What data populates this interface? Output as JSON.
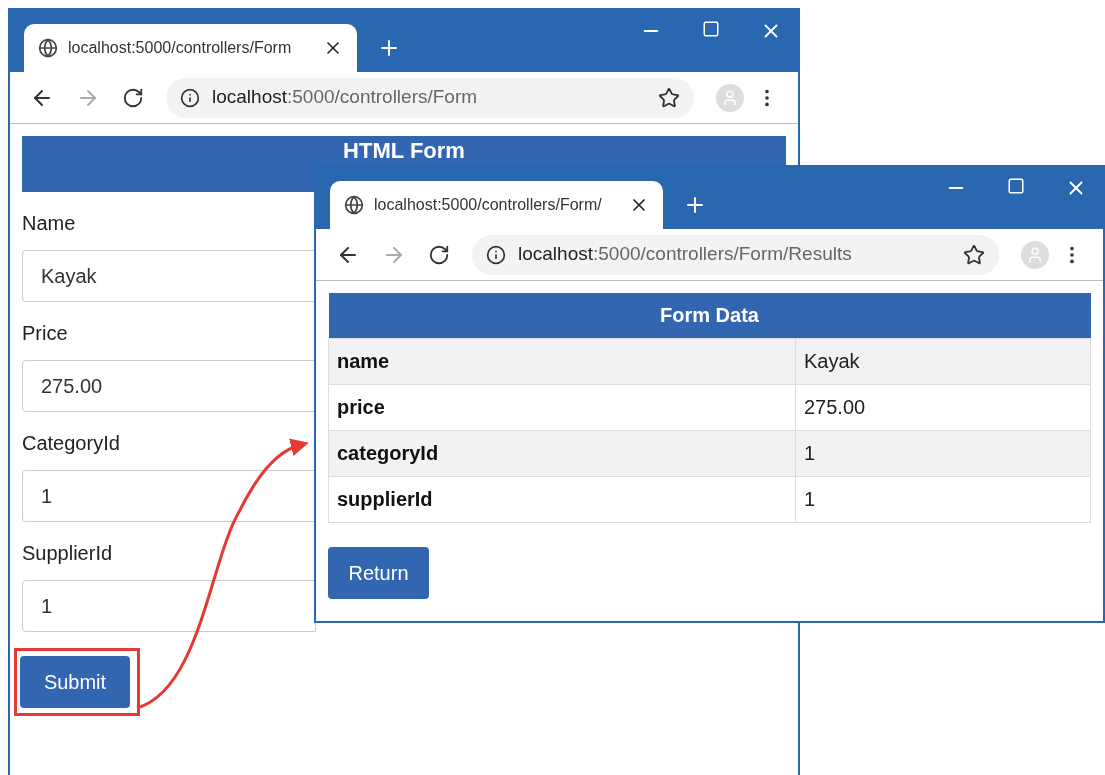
{
  "windows": [
    {
      "kind": "form",
      "tab_title": "localhost:5000/controllers/Form",
      "url_host": "localhost",
      "url_rest": ":5000/controllers/Form",
      "heading": "HTML Form",
      "fields": [
        {
          "label": "Name",
          "value": "Kayak"
        },
        {
          "label": "Price",
          "value": "275.00"
        },
        {
          "label": "CategoryId",
          "value": "1"
        },
        {
          "label": "SupplierId",
          "value": "1"
        }
      ],
      "button": "Submit"
    },
    {
      "kind": "table",
      "tab_title": "localhost:5000/controllers/Form/",
      "url_host": "localhost",
      "url_rest": ":5000/controllers/Form/Results",
      "heading": "Form Data",
      "rows": [
        {
          "key": "name",
          "value": "Kayak"
        },
        {
          "key": "price",
          "value": "275.00"
        },
        {
          "key": "categoryId",
          "value": "1"
        },
        {
          "key": "supplierId",
          "value": "1"
        }
      ],
      "button": "Return"
    }
  ]
}
